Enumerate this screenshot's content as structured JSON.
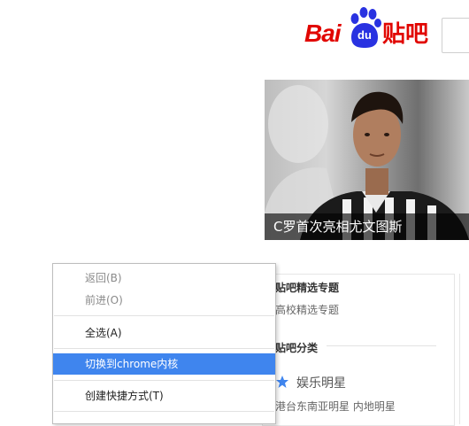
{
  "logo": {
    "bai": "Bai",
    "du": "du",
    "tieba": "贴吧"
  },
  "banner": {
    "caption": "C罗首次亮相尤文图斯"
  },
  "right": {
    "featured_title": "贴吧精选专题",
    "featured_link": "高校精选专题",
    "category_title": "贴吧分类",
    "category_name": "娱乐明星",
    "sub_categories": "港台东南亚明星  内地明星"
  },
  "context_menu": {
    "items": [
      {
        "label": "返回(B)",
        "enabled": false
      },
      {
        "label": "前进(O)",
        "enabled": false
      },
      {
        "label": "全选(A)",
        "enabled": true
      },
      {
        "label": "切换到chrome内核",
        "enabled": true,
        "highlighted": true
      },
      {
        "label": "创建快捷方式(T)",
        "enabled": true
      }
    ]
  },
  "colors": {
    "brand_red": "#e10601",
    "paw_blue": "#2932e1",
    "highlight": "#3f85ee",
    "star": "#3f85ee"
  }
}
